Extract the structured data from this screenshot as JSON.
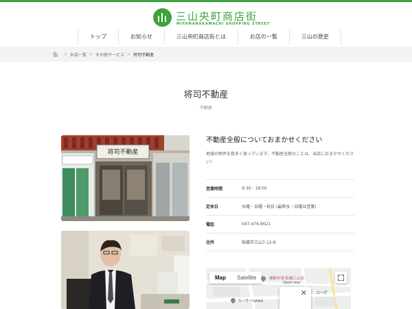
{
  "site": {
    "logo_title": "三山央町商店街",
    "logo_subtitle": "MIYAMANAKAMACHI SHOPPING STREET",
    "brand_color": "#3ba33b"
  },
  "nav": {
    "items": [
      {
        "label": "トップ"
      },
      {
        "label": "お知らせ"
      },
      {
        "label": "三山央町商店街とは"
      },
      {
        "label": "お店の一覧"
      },
      {
        "label": "三山の歴史"
      }
    ]
  },
  "breadcrumb": {
    "items": [
      "お店一覧",
      "その他サービス"
    ],
    "current": "将司不動産",
    "separator": ">"
  },
  "page": {
    "title": "将司不動産",
    "category": "不動産"
  },
  "store": {
    "heading": "不動産全般についておまかせください",
    "description": "地域の物件を数多く扱っています。不動産全般のことは、当店におまかせください！",
    "signboard": "将司不動産",
    "info": [
      {
        "label": "営業時間",
        "value": "9:30 - 18:00"
      },
      {
        "label": "定休日",
        "value": "水曜・日曜・祝日 (最終水・日曜は営業)"
      },
      {
        "label": "電話",
        "value": "047-476-6621"
      },
      {
        "label": "住所",
        "value": "船橋市三山7-12-8"
      }
    ]
  },
  "map": {
    "tabs": {
      "map": "Map",
      "satellite": "Satellite"
    },
    "labels": {
      "market": "模範市場 船橋三山店",
      "open": "Open now",
      "corp": "コーポ",
      "mart": "カーサーHANA"
    },
    "close_glyph": "✕"
  }
}
